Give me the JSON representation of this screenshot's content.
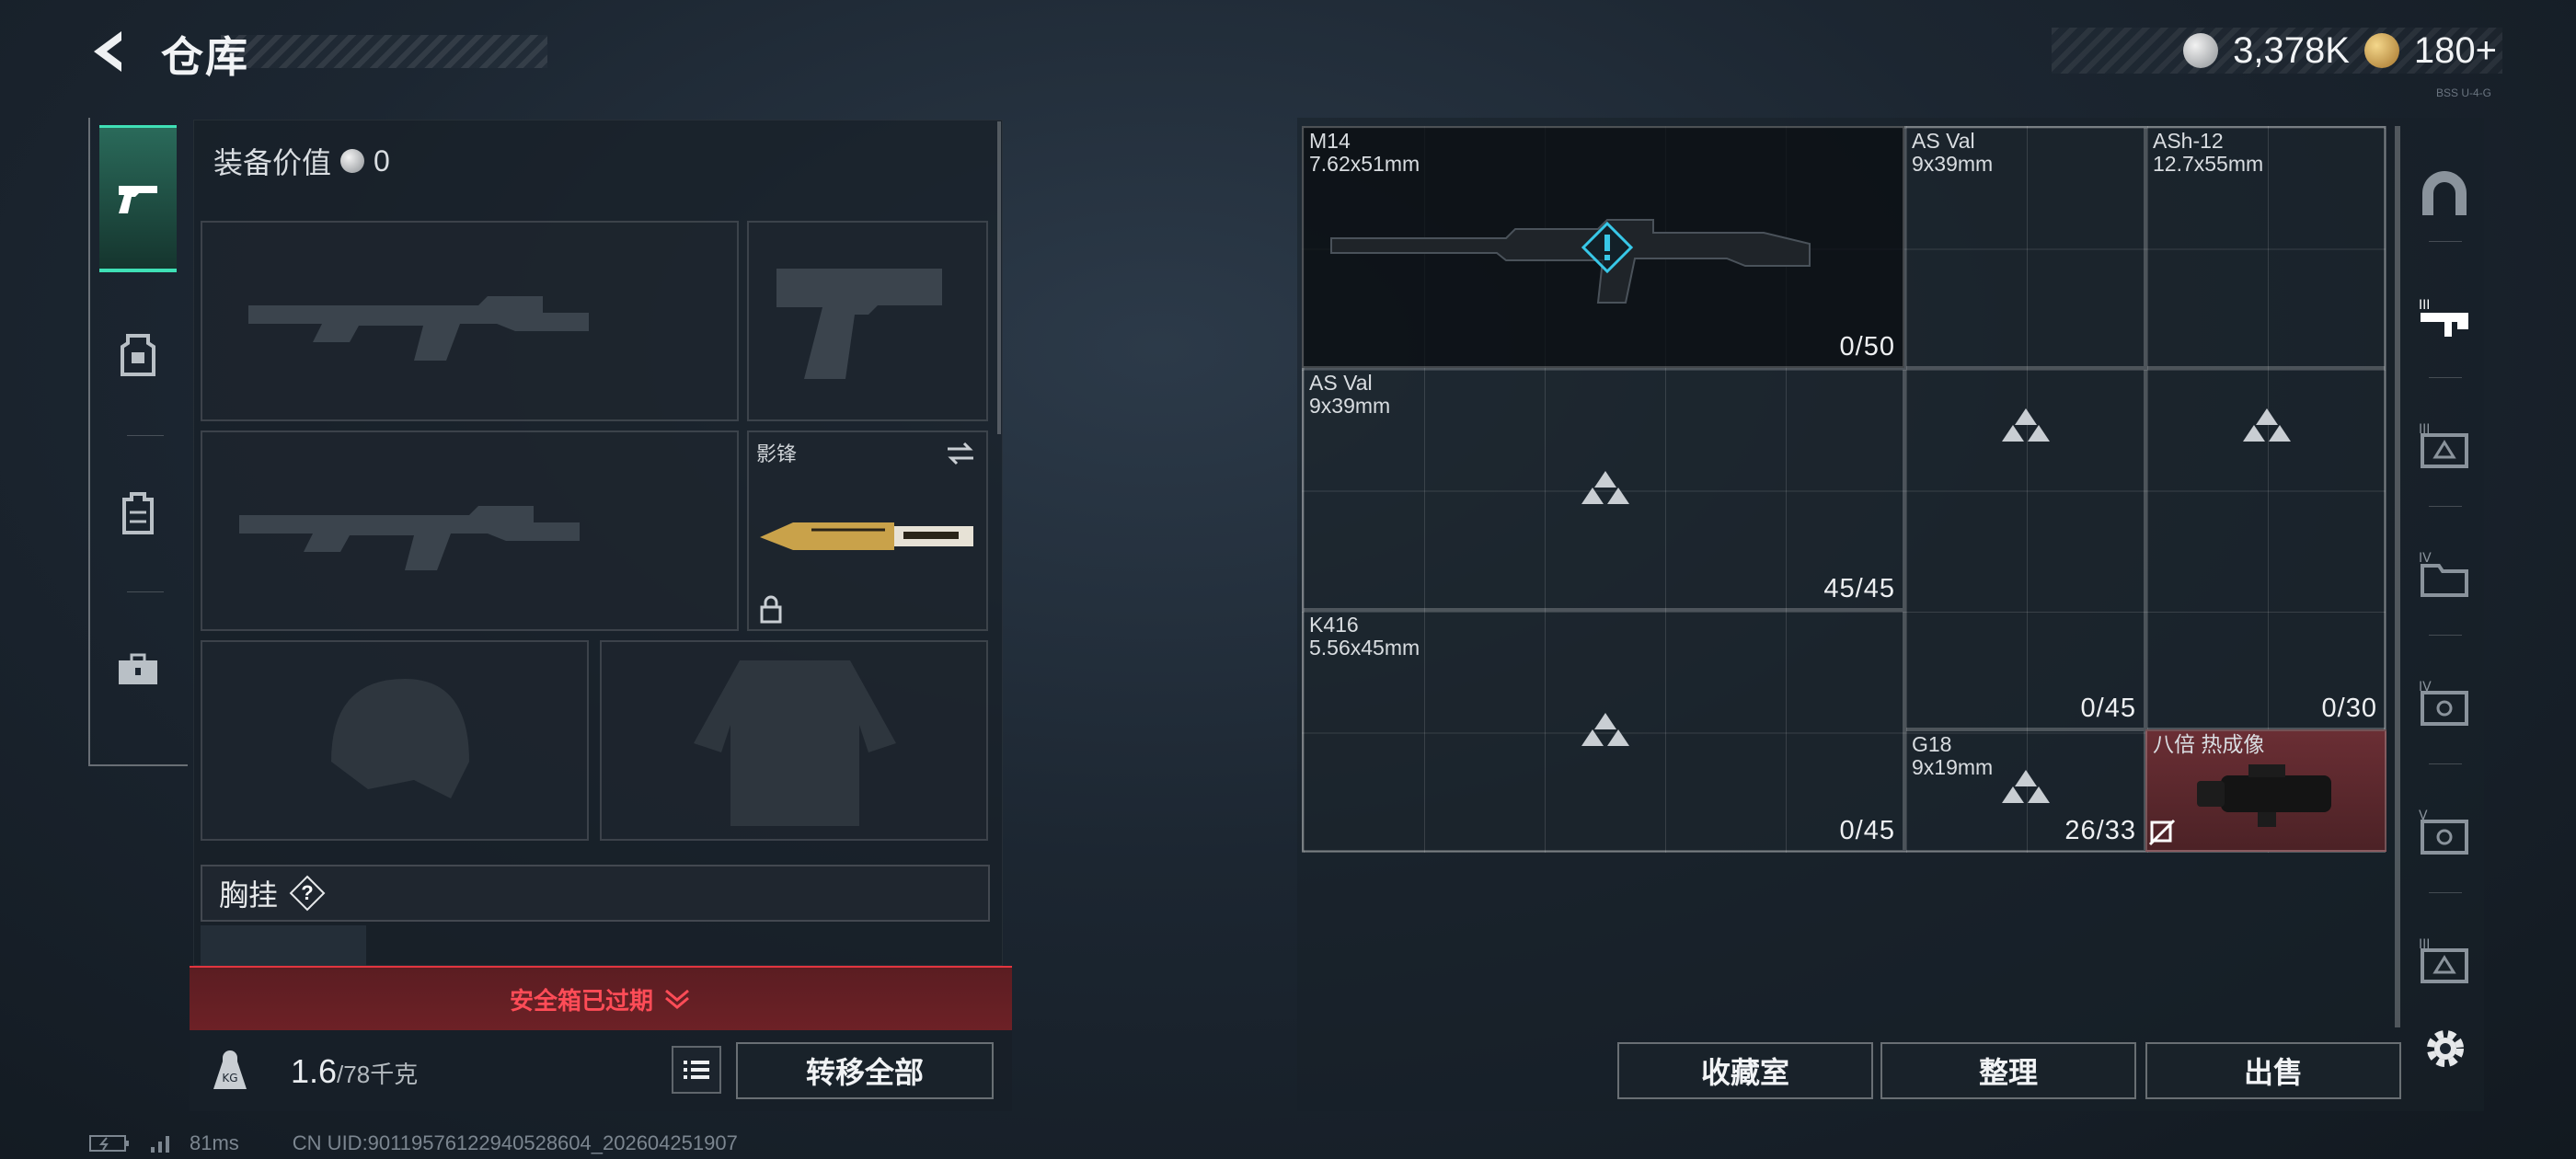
{
  "header": {
    "title": "仓库",
    "currencies": [
      {
        "icon": "silver-coin-icon",
        "value": "3,378K"
      },
      {
        "icon": "gold-coin-icon",
        "value": "180+"
      }
    ],
    "version_tag": "BSS U-4-G"
  },
  "sidebar_tabs": [
    {
      "name": "weapons-tab",
      "icon": "pistol-icon",
      "active": true
    },
    {
      "name": "armor-tab",
      "icon": "vest-icon",
      "active": false
    },
    {
      "name": "backpack-tab",
      "icon": "backpack-icon",
      "active": false
    },
    {
      "name": "toolbox-tab",
      "icon": "toolbox-icon",
      "active": false
    }
  ],
  "equipment": {
    "value_label": "装备价值",
    "value": "0",
    "melee_name": "影锋",
    "chest_rig_label": "胸挂",
    "help_symbol": "?",
    "safe_box_banner": "安全箱已过期"
  },
  "weight": {
    "current": "1.6",
    "max": "/78千克"
  },
  "buttons": {
    "transfer_all": "转移全部",
    "storeroom": "收藏室",
    "sort": "整理",
    "sell": "出售"
  },
  "stash_items": [
    {
      "key": "m14",
      "name": "M14",
      "caliber": "7.62x51mm",
      "count": "0/50"
    },
    {
      "key": "asval1",
      "name": "AS Val",
      "caliber": "9x39mm",
      "count": ""
    },
    {
      "key": "ash12",
      "name": "ASh-12",
      "caliber": "12.7x55mm",
      "count": ""
    },
    {
      "key": "asval2",
      "name": "AS Val",
      "caliber": "9x39mm",
      "count": "45/45"
    },
    {
      "key": "asval1_count",
      "count": "0/45"
    },
    {
      "key": "ash12_count",
      "count": "0/30"
    },
    {
      "key": "k416",
      "name": "K416",
      "caliber": "5.56x45mm",
      "count": "0/45"
    },
    {
      "key": "g18",
      "name": "G18",
      "caliber": "9x19mm",
      "count": "26/33"
    },
    {
      "key": "scope",
      "name": "八倍 热成像",
      "caliber": "",
      "count": ""
    }
  ],
  "status": {
    "ping": "81ms",
    "uid": "CN UID:9011957612294052860​4_202604251907"
  },
  "colors": {
    "accent": "#3fe0b6",
    "danger": "#ff4c57",
    "scope_bg": "#5a2a30"
  }
}
